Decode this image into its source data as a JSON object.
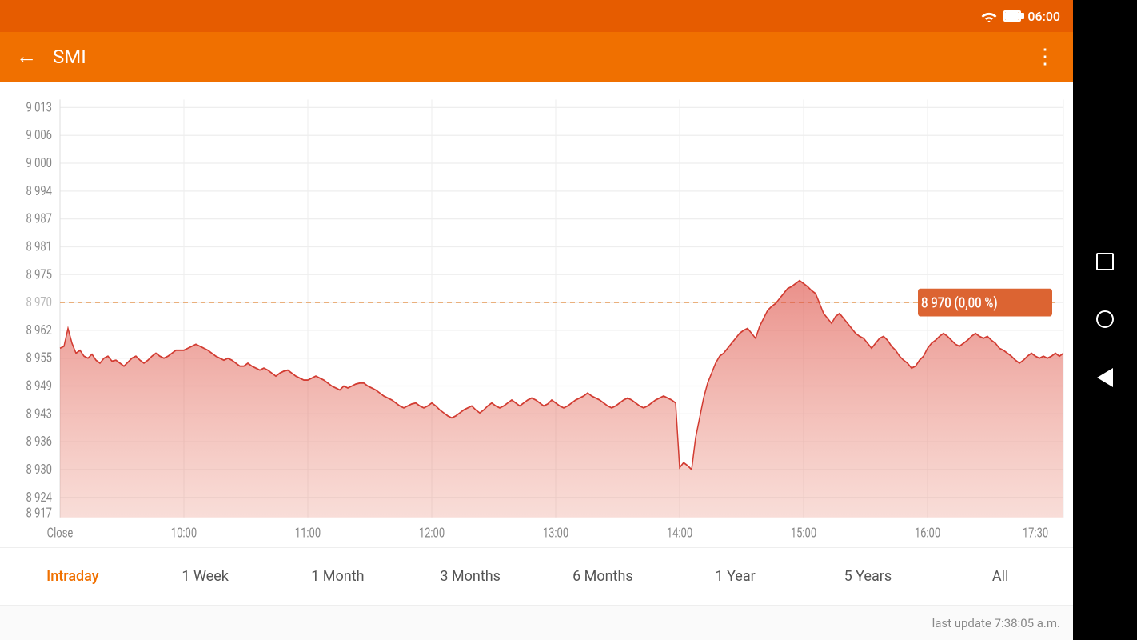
{
  "statusBar": {
    "time": "06:00"
  },
  "appBar": {
    "title": "SMI",
    "backLabel": "←",
    "moreLabel": "⋮"
  },
  "chart": {
    "yAxisLabels": [
      "9 013",
      "9 006",
      "9 000",
      "8 994",
      "8 987",
      "8 981",
      "8 975",
      "8 970",
      "8 962",
      "8 955",
      "8 949",
      "8 943",
      "8 936",
      "8 930",
      "8 924",
      "8 917"
    ],
    "xAxisLabels": [
      "Close",
      "10:00",
      "11:00",
      "12:00",
      "13:00",
      "14:00",
      "15:00",
      "16:00",
      "17:30"
    ],
    "currentValue": "8 970",
    "currentChange": "(0,00 %)"
  },
  "periodSelector": {
    "items": [
      {
        "label": "Intraday",
        "active": true
      },
      {
        "label": "1 Week",
        "active": false
      },
      {
        "label": "1 Month",
        "active": false
      },
      {
        "label": "3 Months",
        "active": false
      },
      {
        "label": "6 Months",
        "active": false
      },
      {
        "label": "1 Year",
        "active": false
      },
      {
        "label": "5 Years",
        "active": false
      },
      {
        "label": "All",
        "active": false
      }
    ]
  },
  "footer": {
    "lastUpdate": "last update 7:38:05 a.m."
  },
  "colors": {
    "orangeAccent": "#f07000",
    "chartFill": "rgba(220,80,60,0.35)",
    "chartLine": "rgb(210,60,50)",
    "dashLine": "#e8a060"
  }
}
